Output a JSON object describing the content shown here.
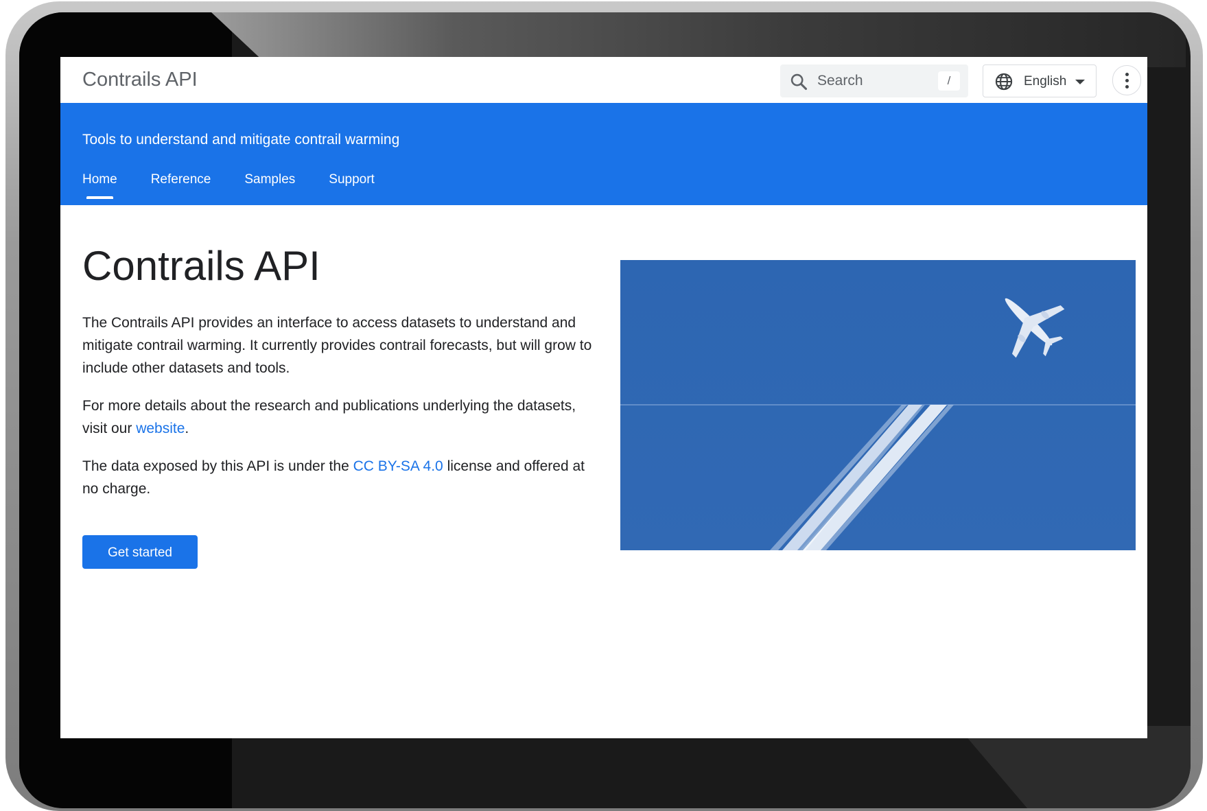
{
  "header": {
    "site_title": "Contrails API",
    "search": {
      "placeholder": "Search",
      "shortcut": "/"
    },
    "language": {
      "selected": "English"
    }
  },
  "banner": {
    "tagline": "Tools to understand and mitigate contrail warming",
    "tabs": [
      {
        "label": "Home",
        "active": true
      },
      {
        "label": "Reference",
        "active": false
      },
      {
        "label": "Samples",
        "active": false
      },
      {
        "label": "Support",
        "active": false
      }
    ]
  },
  "main": {
    "title": "Contrails API",
    "p1": "The Contrails API provides an interface to access datasets to understand and mitigate contrail warming. It currently provides contrail forecasts, but will grow to include other datasets and tools.",
    "p2_before": "For more details about the research and publications underlying the datasets, visit our ",
    "p2_link": "website",
    "p2_after": ".",
    "p3_before": "The data exposed by this API is under the ",
    "p3_link": "CC BY-SA 4.0",
    "p3_after": " license and offered at no charge.",
    "cta_label": "Get started"
  },
  "colors": {
    "brand_blue": "#1a73e8",
    "sky_blue": "#2f68b3"
  },
  "icons": {
    "search": "search-icon",
    "language": "globe-icon",
    "caret": "caret-down-icon",
    "more": "more-vert-icon"
  }
}
